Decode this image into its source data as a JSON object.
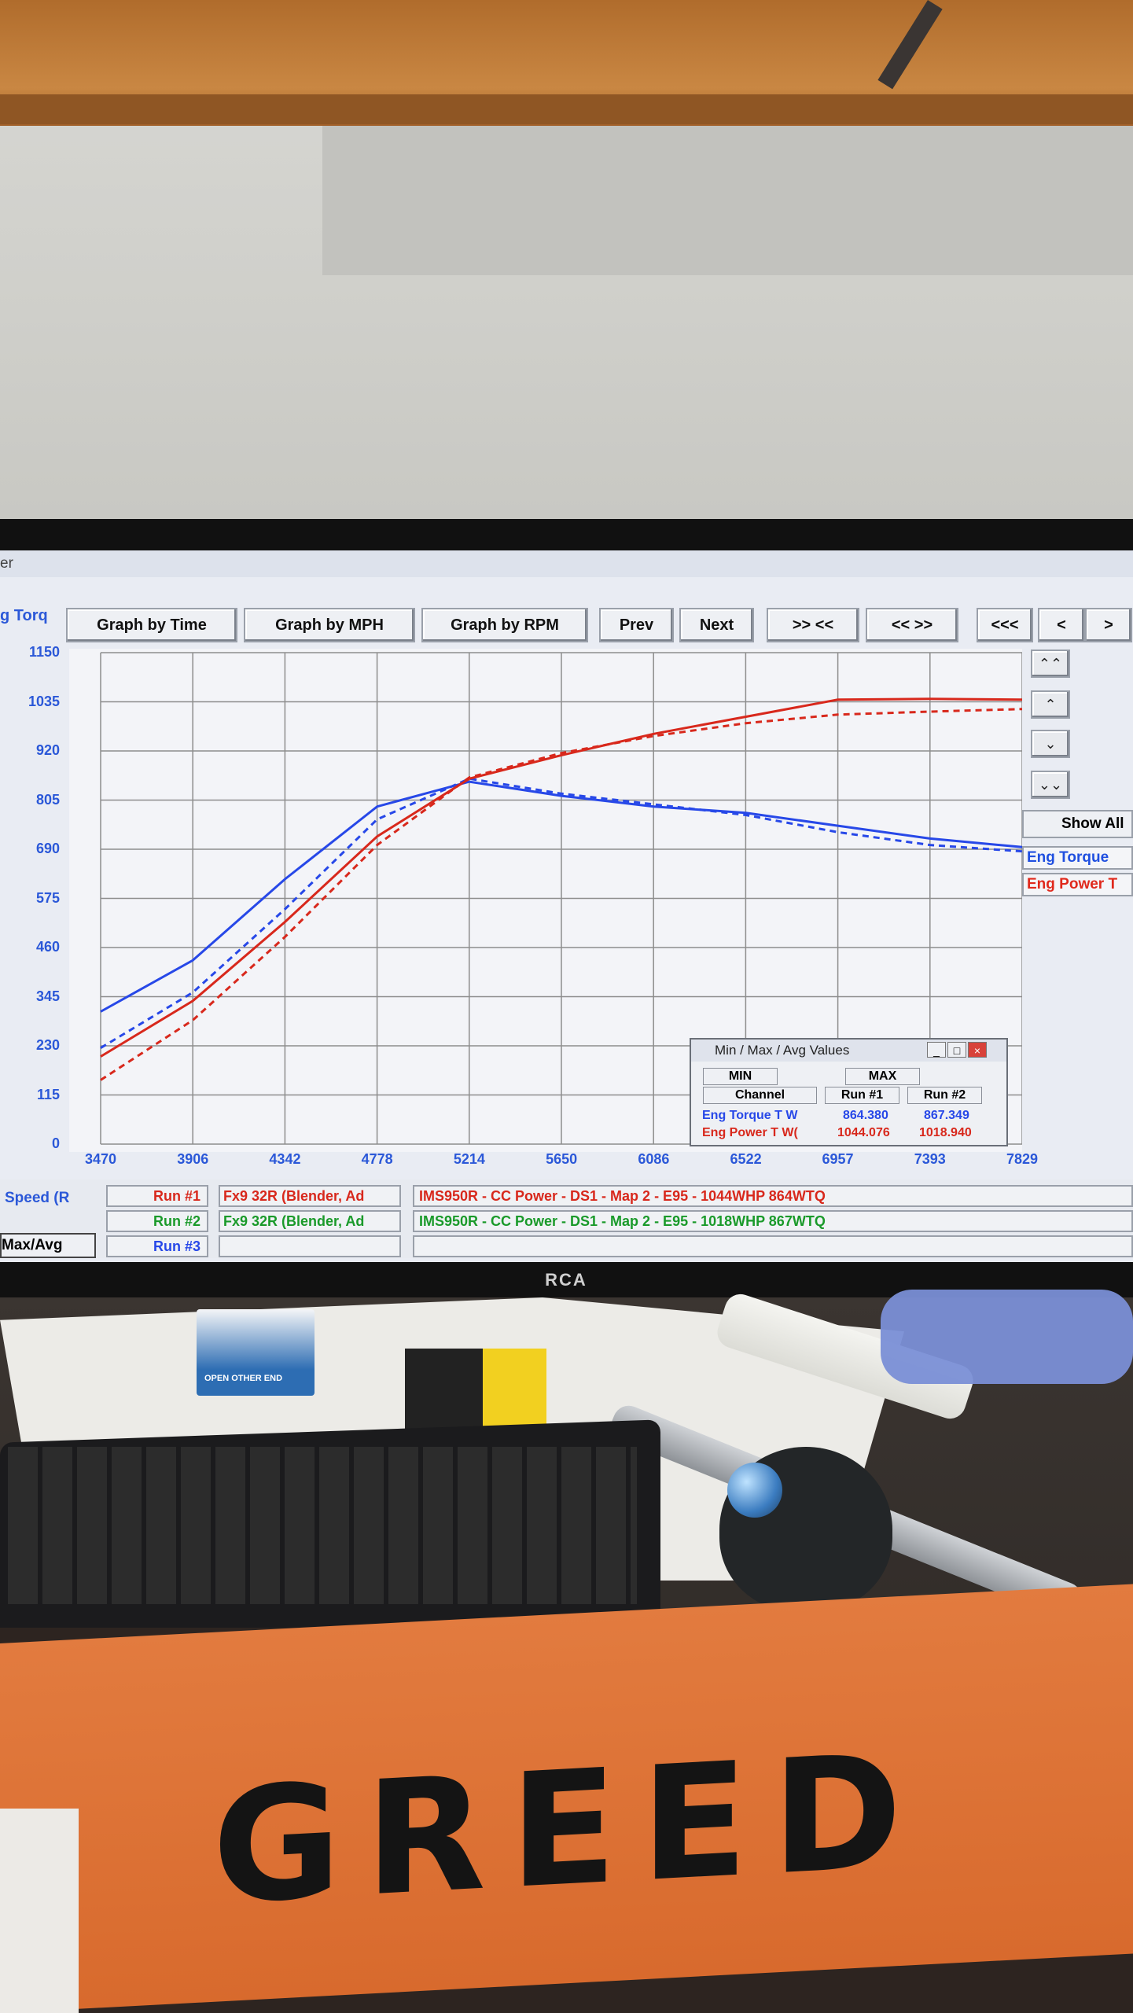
{
  "window": {
    "title_fragment": "er"
  },
  "left_labels": {
    "y_channel": "g Torq",
    "x_channel": "Speed (R",
    "minmax": "Max/Avg"
  },
  "toolbar": {
    "graph_time": "Graph by Time",
    "graph_mph": "Graph by MPH",
    "graph_rpm": "Graph by RPM",
    "prev": "Prev",
    "next": "Next",
    "zoom_in": ">> <<",
    "zoom_out": "<< >>",
    "first": "<<<",
    "back": "<",
    "forward": ">"
  },
  "side_buttons": {
    "top": "⌃⌃",
    "up": "⌃",
    "down": "⌄",
    "bottom": "⌄⌄"
  },
  "show_all": "Show All",
  "channels": [
    {
      "label": "Eng Torque",
      "color": "#1f4fe0"
    },
    {
      "label": "Eng Power T",
      "color": "#e0291c"
    }
  ],
  "colors": {
    "torque": "#2748e8",
    "power": "#d8281c",
    "axis_text": "#2b58d8",
    "grid": "#8d8d8d",
    "run2": "#1a9a2a"
  },
  "chart_data": {
    "type": "line",
    "xlabel": "",
    "ylabel": "",
    "xlim": [
      3470,
      7829
    ],
    "ylim": [
      0,
      1150
    ],
    "x_ticks": [
      "3470",
      "3906",
      "4342",
      "4778",
      "5214",
      "5650",
      "6086",
      "6522",
      "6957",
      "7393",
      "7829"
    ],
    "y_ticks": [
      "1150",
      "1035",
      "920",
      "805",
      "690",
      "575",
      "460",
      "345",
      "230",
      "115",
      "0"
    ],
    "x": [
      3470,
      3906,
      4342,
      4778,
      5214,
      5650,
      6086,
      6522,
      6957,
      7393,
      7829
    ],
    "series": [
      {
        "name": "",
        "run": 1,
        "style": "solid",
        "color": "#2748e8",
        "values": [
          310,
          430,
          620,
          790,
          848,
          815,
          790,
          775,
          745,
          715,
          695
        ]
      },
      {
        "name": "",
        "run": 2,
        "style": "dashed",
        "color": "#2748e8",
        "values": [
          225,
          355,
          550,
          760,
          855,
          820,
          795,
          770,
          730,
          700,
          685
        ]
      },
      {
        "name": "",
        "run": 1,
        "style": "solid",
        "color": "#d8281c",
        "values": [
          205,
          335,
          520,
          720,
          855,
          910,
          960,
          1000,
          1040,
          1042,
          1040
        ]
      },
      {
        "name": "",
        "run": 2,
        "style": "dashed",
        "color": "#d8281c",
        "values": [
          150,
          290,
          485,
          700,
          858,
          915,
          955,
          985,
          1005,
          1012,
          1018
        ]
      }
    ]
  },
  "runs": [
    {
      "label": "Run #1",
      "car": "Fx9 32R (Blender, Ad",
      "desc": "IMS950R - CC Power - DS1 - Map 2 - E95 - 1044WHP 864WTQ",
      "color": "#d8281c"
    },
    {
      "label": "Run #2",
      "car": "Fx9 32R (Blender, Ad",
      "desc": "IMS950R - CC Power - DS1 - Map 2 - E95 - 1018WHP 867WTQ",
      "color": "#1a9a2a"
    },
    {
      "label": "Run #3",
      "car": "",
      "desc": "",
      "color": "#2748e8"
    }
  ],
  "minmax": {
    "title": "Min / Max / Avg Values",
    "min": "MIN",
    "max": "MAX",
    "col_channel": "Channel",
    "col_run1": "Run #1",
    "col_run2": "Run #2",
    "rows": [
      {
        "channel": "Eng Torque T W",
        "run1": "864.380",
        "run2": "867.349",
        "color": "#2748e8"
      },
      {
        "channel": "Eng Power T W(",
        "run1": "1044.076",
        "run2": "1018.940",
        "color": "#d8281c"
      }
    ]
  },
  "monitor_brand": "RCA",
  "sign": "GREED",
  "desk_items": {
    "pack_text": "OPEN OTHER END"
  }
}
